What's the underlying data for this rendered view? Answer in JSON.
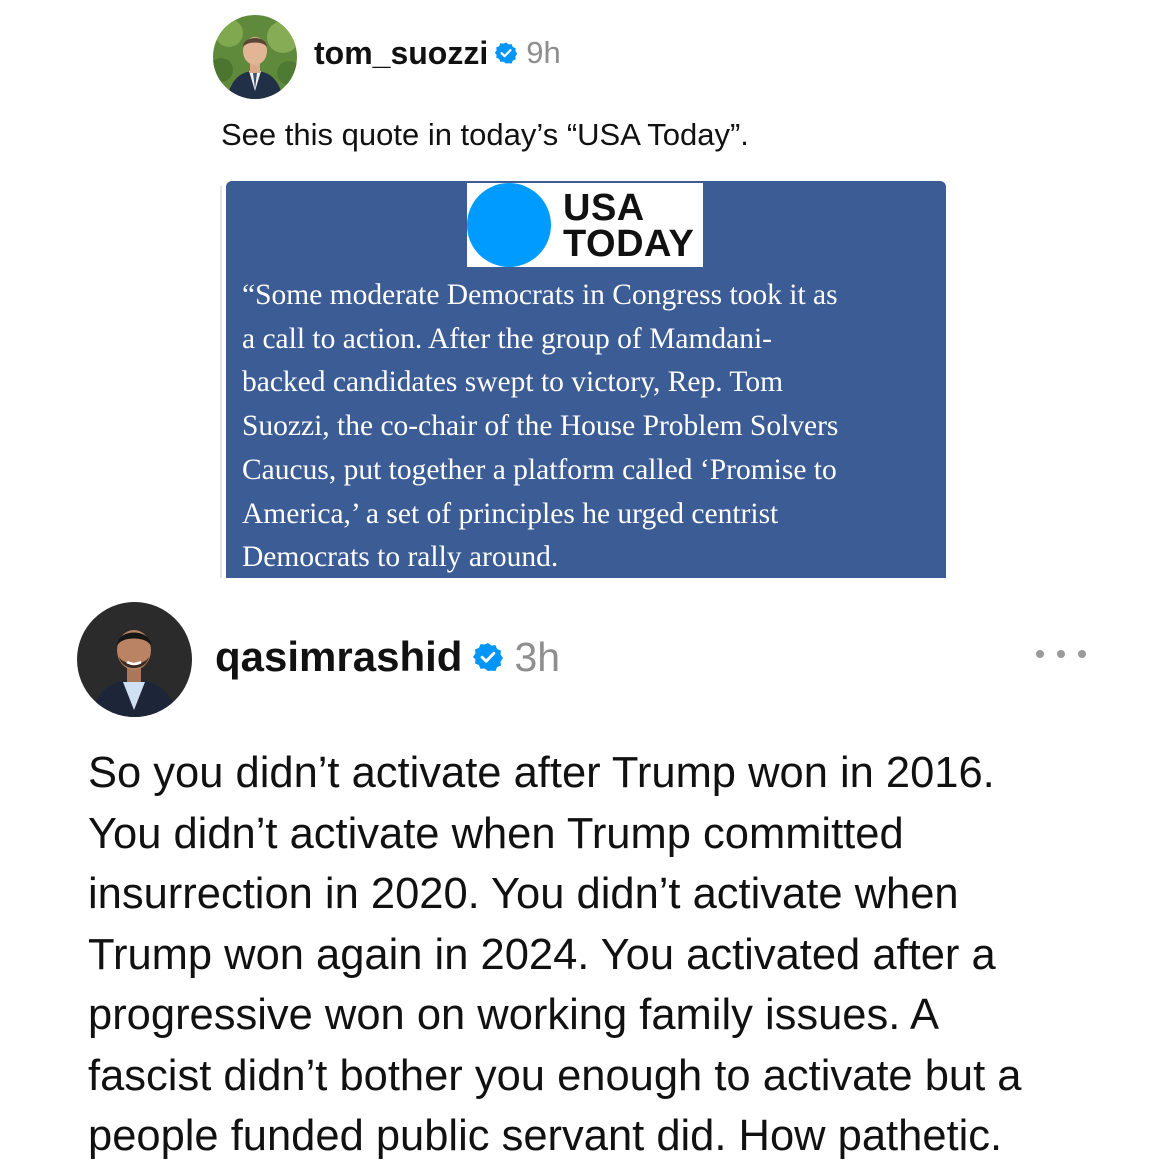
{
  "quoted_post": {
    "username": "tom_suozzi",
    "verified_icon": "verified-badge-icon",
    "time": "9h",
    "text": "See this quote in today’s “USA Today”.",
    "image": {
      "logo_line1": "USA",
      "logo_line2": "TODAY",
      "quote_lines": [
        "“Some moderate Democrats in Congress took it as",
        "a call to action. After the group of Mamdani-",
        "backed candidates swept to victory, Rep. Tom",
        "Suozzi, the co-chair of the House Problem Solvers",
        "Caucus, put together a platform called ‘Promise to",
        "America,’ a set of principles he urged centrist",
        "Democrats to rally around."
      ],
      "background_color": "#3c5c95",
      "logo_dot_color": "#009bff"
    }
  },
  "reply_post": {
    "username": "qasimrashid",
    "verified_icon": "verified-badge-icon",
    "time": "3h",
    "more_icon": "more-options-icon",
    "text_lines": [
      "So you didn’t activate after Trump won in 2016.",
      "You didn’t activate when Trump committed",
      "insurrection in 2020. You didn’t activate when",
      "Trump won again in 2024. You activated after a",
      "progressive won on working family issues. A",
      "fascist didn’t bother you enough to activate but a",
      "people funded public servant did. How pathetic."
    ]
  },
  "colors": {
    "verified_blue": "#0095f6",
    "muted_text": "#8e8e8e"
  }
}
